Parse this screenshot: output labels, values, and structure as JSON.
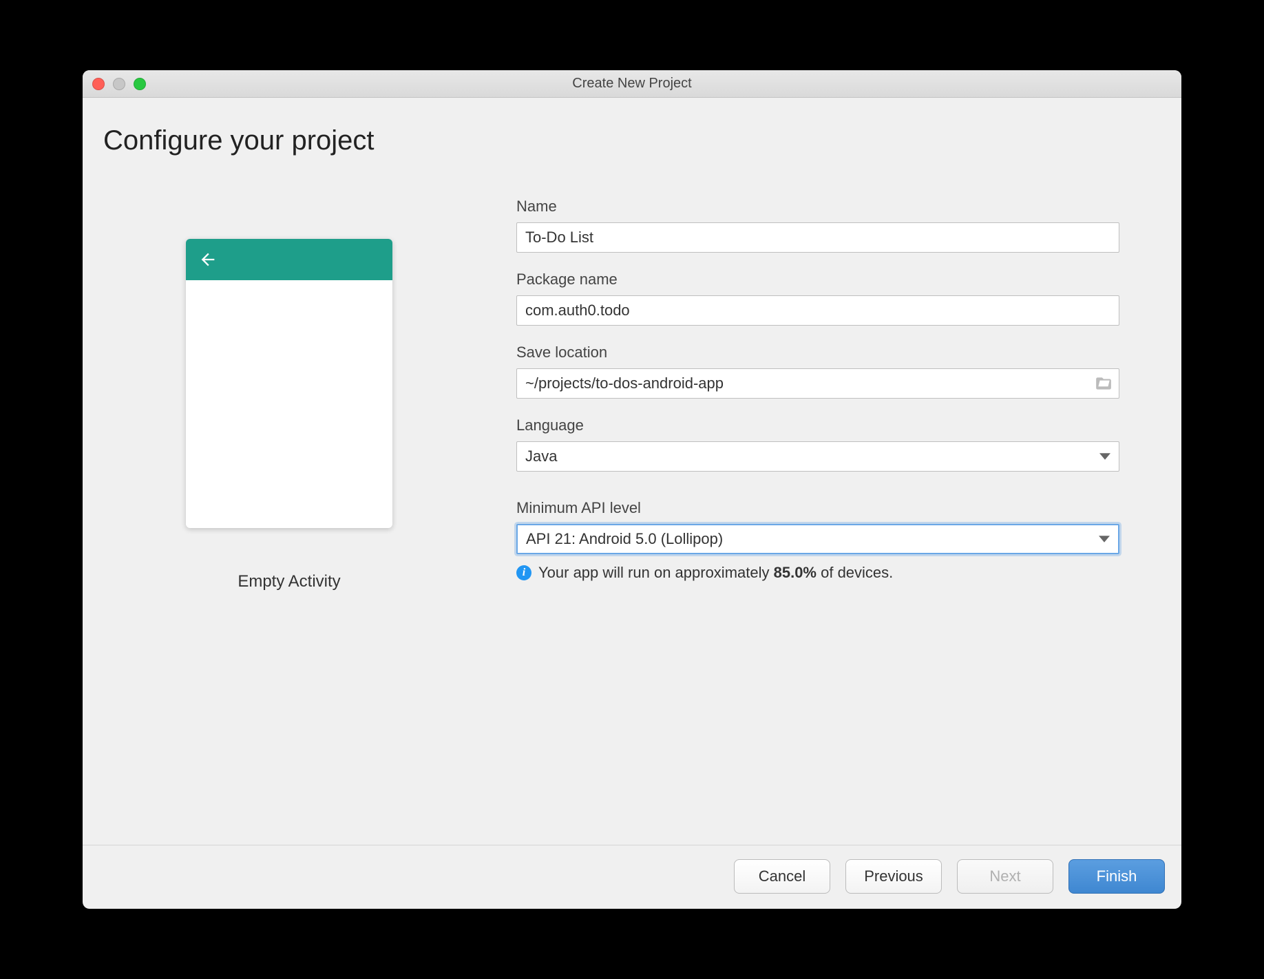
{
  "window": {
    "title": "Create New Project"
  },
  "page": {
    "heading": "Configure your project"
  },
  "preview": {
    "caption": "Empty Activity"
  },
  "form": {
    "name": {
      "label": "Name",
      "value": "To-Do List"
    },
    "package": {
      "label": "Package name",
      "value": "com.auth0.todo"
    },
    "location": {
      "label": "Save location",
      "value": "~/projects/to-dos-android-app"
    },
    "language": {
      "label": "Language",
      "value": "Java"
    },
    "api": {
      "label": "Minimum API level",
      "value": "API 21: Android 5.0 (Lollipop)"
    },
    "info": {
      "prefix": "Your app will run on approximately ",
      "pct": "85.0%",
      "suffix": " of devices."
    }
  },
  "footer": {
    "cancel": "Cancel",
    "previous": "Previous",
    "next": "Next",
    "finish": "Finish"
  }
}
